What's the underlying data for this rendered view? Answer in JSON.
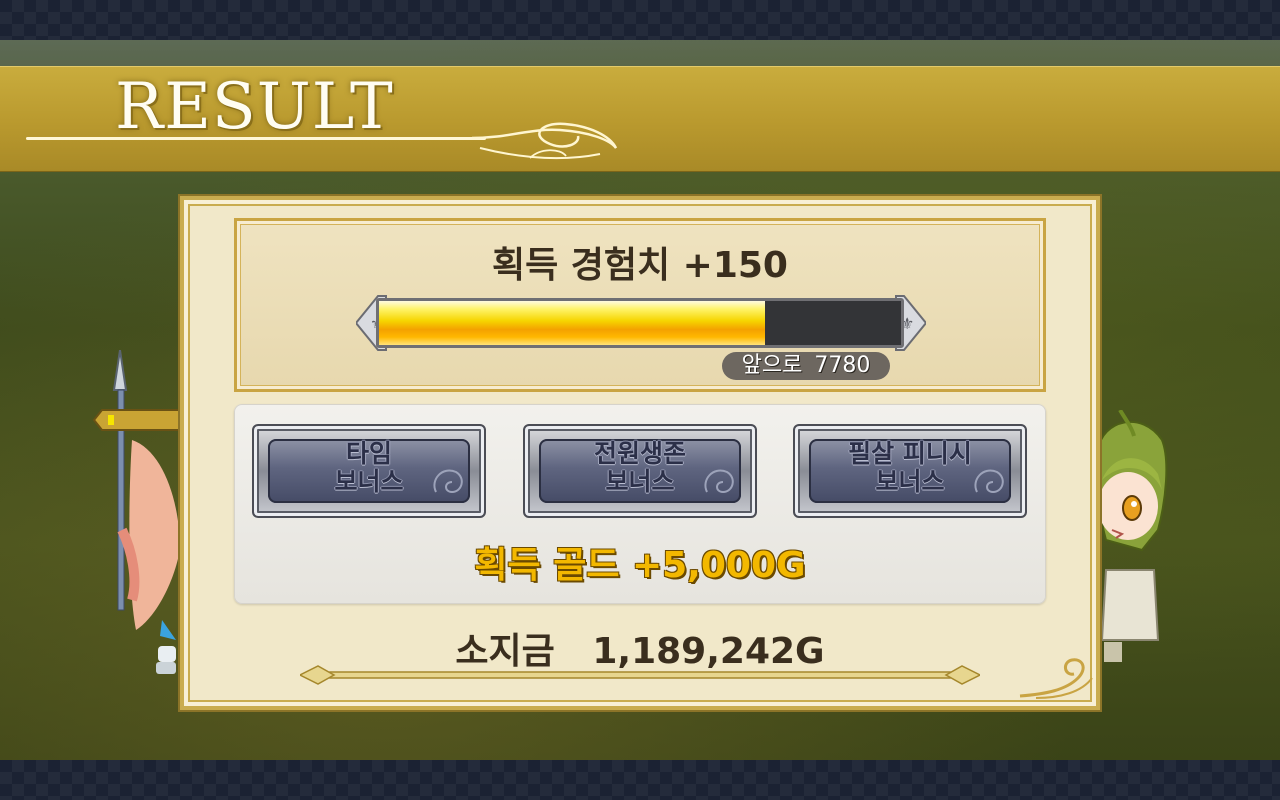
{
  "header": {
    "title": "RESULT"
  },
  "experience": {
    "title": "획득 경험치 +150",
    "progress_fraction": 0.74,
    "remaining_label": "앞으로",
    "remaining_value": "7780"
  },
  "bonuses": [
    {
      "label": "타임\n보너스"
    },
    {
      "label": "전원생존\n보너스"
    },
    {
      "label": "필살 피니시\n보너스"
    }
  ],
  "gold_earned": "획득 골드 +5,000G",
  "holdings": "소지금   1,189,242G",
  "colors": {
    "banner_gold": "#b9992e",
    "exp_fill": "#f6d500",
    "gold_text": "#f3b800",
    "panel_bg": "#f1e8c9"
  },
  "icons": [
    "swirl-ornament-icon",
    "exp-bar-end-cap-icon",
    "corner-ornament-icon"
  ]
}
